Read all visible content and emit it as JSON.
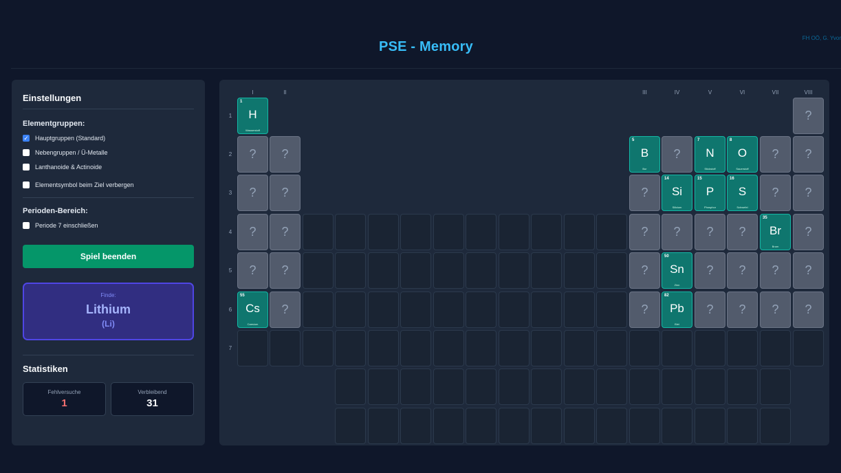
{
  "header": {
    "title": "PSE - Memory",
    "credit": "FH OÖ, G. Yvor"
  },
  "settings": {
    "title": "Einstellungen",
    "groups_label": "Elementgruppen:",
    "main_groups": {
      "label": "Hauptgruppen (Standard)",
      "checked": true
    },
    "sub_groups": {
      "label": "Nebengruppen / Ü-Metalle",
      "checked": false
    },
    "lanthanides": {
      "label": "Lanthanoide & Actinoide",
      "checked": false
    },
    "hide_symbol": {
      "label": "Elementsymbol beim Ziel verbergen",
      "checked": false
    },
    "period_label": "Perioden-Bereich:",
    "period7": {
      "label": "Periode 7 einschließen",
      "checked": false
    },
    "end_button": "Spiel beenden"
  },
  "target": {
    "label": "Finde:",
    "name": "Lithium",
    "symbol": "(Li)"
  },
  "stats": {
    "title": "Statistiken",
    "errors_label": "Fehlversuche",
    "errors_value": "1",
    "remaining_label": "Verbleibend",
    "remaining_value": "31"
  },
  "colors": {
    "error": "#f87171",
    "remaining": "#f8fafc"
  },
  "board": {
    "group_labels": [
      "I",
      "II",
      "III",
      "IV",
      "V",
      "VI",
      "VII",
      "VIII"
    ],
    "period_labels": [
      "1",
      "2",
      "3",
      "4",
      "5",
      "6",
      "7"
    ],
    "hidden_mark": "?",
    "found": [
      {
        "row": 1,
        "col": 1,
        "num": "1",
        "sym": "H",
        "name": "Wasserstoff"
      },
      {
        "row": 2,
        "col": 13,
        "num": "5",
        "sym": "B",
        "name": "Bor"
      },
      {
        "row": 2,
        "col": 15,
        "num": "7",
        "sym": "N",
        "name": "Stickstoff"
      },
      {
        "row": 2,
        "col": 16,
        "num": "8",
        "sym": "O",
        "name": "Sauerstoff"
      },
      {
        "row": 3,
        "col": 14,
        "num": "14",
        "sym": "Si",
        "name": "Silicium"
      },
      {
        "row": 3,
        "col": 15,
        "num": "15",
        "sym": "P",
        "name": "Phosphor"
      },
      {
        "row": 3,
        "col": 16,
        "num": "16",
        "sym": "S",
        "name": "Schwefel"
      },
      {
        "row": 4,
        "col": 17,
        "num": "35",
        "sym": "Br",
        "name": "Brom"
      },
      {
        "row": 5,
        "col": 14,
        "num": "50",
        "sym": "Sn",
        "name": "Zinn"
      },
      {
        "row": 6,
        "col": 1,
        "num": "55",
        "sym": "Cs",
        "name": "Caesium"
      },
      {
        "row": 6,
        "col": 14,
        "num": "82",
        "sym": "Pb",
        "name": "Blei"
      }
    ]
  }
}
